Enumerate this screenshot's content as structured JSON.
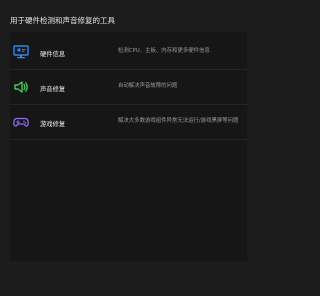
{
  "header": {
    "title": "用于硬件检测和声音修复的工具"
  },
  "tools": [
    {
      "name": "硬件信息",
      "description": "检测CPU、主板、内存和更多硬件信息",
      "icon": "monitor-icon",
      "icon_color": "#2a8bf2"
    },
    {
      "name": "声音修复",
      "description": "自动解决声音故障的问题",
      "icon": "speaker-icon",
      "icon_color": "#3fcf5a"
    },
    {
      "name": "游戏修复",
      "description": "解决大多数游戏组件异常无法运行/游戏黑屏等问题",
      "icon": "gamepad-icon",
      "icon_color": "#8a6cf0"
    }
  ]
}
